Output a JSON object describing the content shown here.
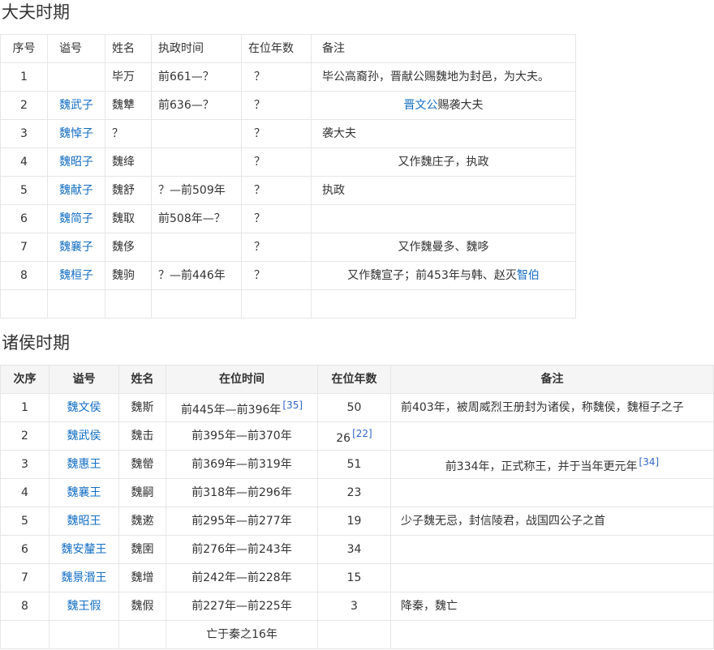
{
  "section1": {
    "title": "大夫时期",
    "headers": [
      "序号",
      "谥号",
      "姓名",
      "执政时间",
      "在位年数",
      "备注"
    ],
    "rows": [
      {
        "no": "1",
        "posthumous": "",
        "name": "毕万",
        "time": "前661—？",
        "years": "？",
        "note": "毕公高裔孙，晋献公赐魏地为封邑，为大夫。",
        "note_align": "l"
      },
      {
        "no": "2",
        "posthumous": "魏武子",
        "name": "魏犨",
        "time": "前636—？",
        "years": "？",
        "note_link": "晋文公",
        "note": "赐袭大夫",
        "note_align": "c"
      },
      {
        "no": "3",
        "posthumous": "魏悼子",
        "name": "？",
        "time": "",
        "years": "？",
        "note": "袭大夫",
        "note_align": "l"
      },
      {
        "no": "4",
        "posthumous": "魏昭子",
        "name": "魏绛",
        "time": "",
        "years": "？",
        "note": "又作魏庄子，执政",
        "note_align": "c"
      },
      {
        "no": "5",
        "posthumous": "魏献子",
        "name": "魏舒",
        "time": "？—前509年",
        "years": "？",
        "note": "执政",
        "note_align": "l"
      },
      {
        "no": "6",
        "posthumous": "魏简子",
        "name": "魏取",
        "time": "前508年—？",
        "years": "？",
        "note": "",
        "note_align": "l"
      },
      {
        "no": "7",
        "posthumous": "魏襄子",
        "name": "魏侈",
        "time": "",
        "years": "？",
        "note": "又作魏曼多、魏哆",
        "note_align": "c"
      },
      {
        "no": "8",
        "posthumous": "魏桓子",
        "name": "魏驹",
        "time": "？—前446年",
        "years": "？",
        "note": "又作魏宣子；前453年与韩、赵灭",
        "note_link_after": "智伯",
        "note_align": "c"
      }
    ]
  },
  "section2": {
    "title": "诸侯时期",
    "headers": [
      "次序",
      "谥号",
      "姓名",
      "在位时间",
      "在位年数",
      "备注"
    ],
    "rows": [
      {
        "no": "1",
        "posthumous": "魏文侯",
        "name": "魏斯",
        "time": "前445年—前396年",
        "time_ref": "[35]",
        "years": "50",
        "years_ref": "",
        "note": "前403年，被周威烈王册封为诸侯，称魏侯，魏桓子之子",
        "note_ref": "",
        "note_align": "l"
      },
      {
        "no": "2",
        "posthumous": "魏武侯",
        "name": "魏击",
        "time": "前395年—前370年",
        "time_ref": "",
        "years": "26",
        "years_ref": "[22]",
        "note": "",
        "note_ref": "",
        "note_align": "l"
      },
      {
        "no": "3",
        "posthumous": "魏惠王",
        "name": "魏罃",
        "time": "前369年—前319年",
        "time_ref": "",
        "years": "51",
        "years_ref": "",
        "note": "前334年，正式称王，并于当年更元年",
        "note_ref": "[34]",
        "note_align": "c"
      },
      {
        "no": "4",
        "posthumous": "魏襄王",
        "name": "魏嗣",
        "time": "前318年—前296年",
        "time_ref": "",
        "years": "23",
        "years_ref": "",
        "note": "",
        "note_ref": "",
        "note_align": "l"
      },
      {
        "no": "5",
        "posthumous": "魏昭王",
        "name": "魏遬",
        "time": "前295年—前277年",
        "time_ref": "",
        "years": "19",
        "years_ref": "",
        "note": "少子魏无忌，封信陵君，战国四公子之首",
        "note_ref": "",
        "note_align": "l"
      },
      {
        "no": "6",
        "posthumous": "魏安釐王",
        "name": "魏圉",
        "time": "前276年—前243年",
        "time_ref": "",
        "years": "34",
        "years_ref": "",
        "note": "",
        "note_ref": "",
        "note_align": "l"
      },
      {
        "no": "7",
        "posthumous": "魏景湣王",
        "name": "魏增",
        "time": "前242年—前228年",
        "time_ref": "",
        "years": "15",
        "years_ref": "",
        "note": "",
        "note_ref": "",
        "note_align": "l"
      },
      {
        "no": "8",
        "posthumous": "魏王假",
        "name": "魏假",
        "time": "前227年—前225年",
        "time_ref": "",
        "years": "3",
        "years_ref": "",
        "note": "降秦，魏亡",
        "note_ref": "",
        "note_align": "l"
      }
    ],
    "footer": "亡于秦之16年"
  },
  "colors": {
    "link": "#136ec2",
    "ref": "#3366cc",
    "border": "#e6e6e6",
    "header_bg": "#f5f5f5"
  }
}
